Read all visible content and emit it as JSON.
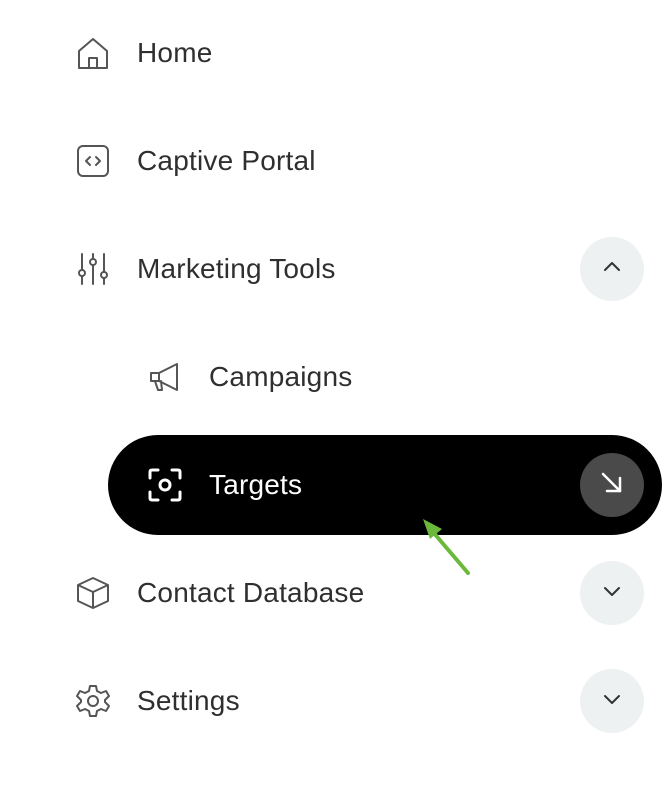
{
  "nav": {
    "items": [
      {
        "label": "Home",
        "icon": "home-icon"
      },
      {
        "label": "Captive Portal",
        "icon": "code-icon"
      },
      {
        "label": "Marketing Tools",
        "icon": "sliders-icon",
        "expanded": true
      },
      {
        "label": "Campaigns",
        "icon": "megaphone-icon"
      },
      {
        "label": "Targets",
        "icon": "focus-target-icon",
        "active": true
      },
      {
        "label": "Contact Database",
        "icon": "box-icon",
        "expanded": false
      },
      {
        "label": "Settings",
        "icon": "gear-icon",
        "expanded": false
      }
    ]
  },
  "colors": {
    "active_bg": "#000000",
    "chevron_bg": "#eef1f2",
    "go_button_bg": "#4a4a4a",
    "pointer_arrow": "#6ab93a"
  }
}
